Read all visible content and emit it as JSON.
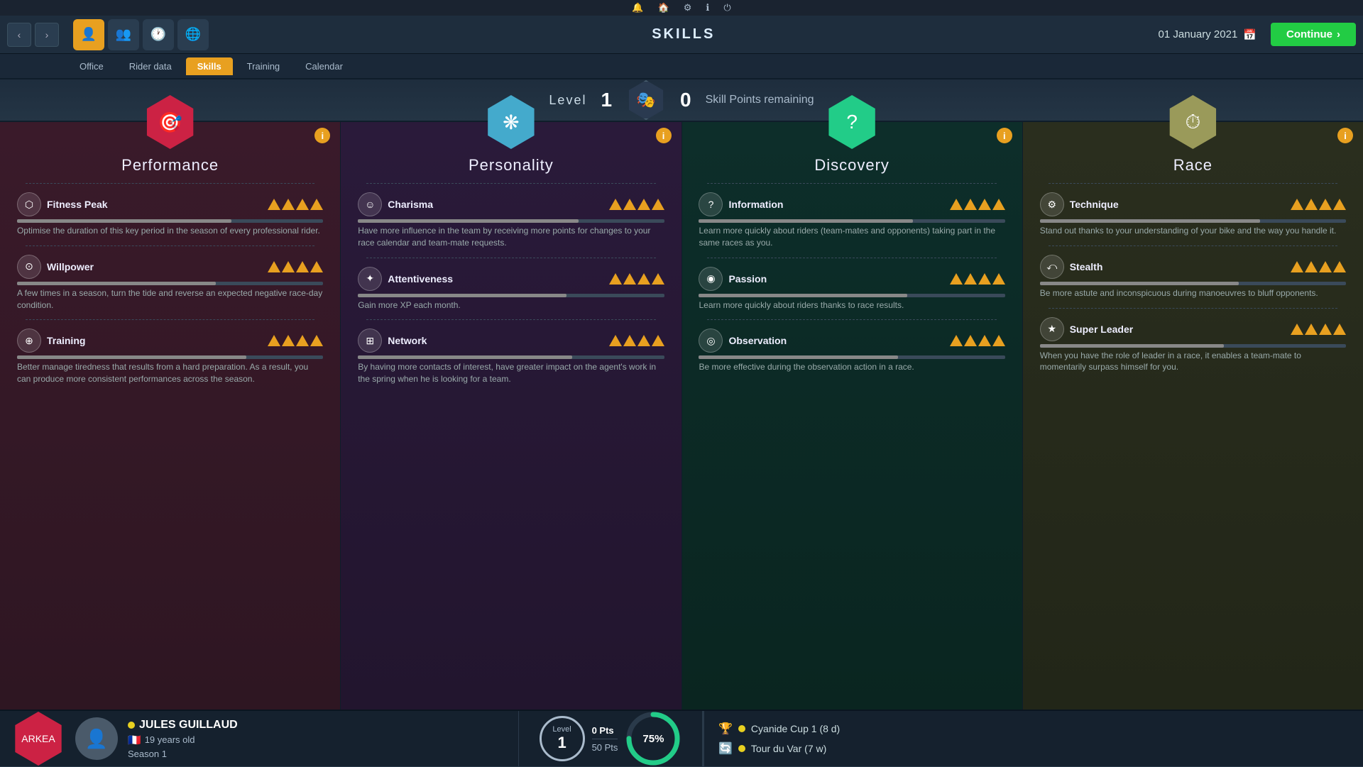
{
  "topbar": {
    "icons": [
      "🔔",
      "🏠",
      "⚙",
      "ℹ",
      "⏻"
    ]
  },
  "navbar": {
    "title": "SKILLS",
    "date": "01 January 2021",
    "continue_label": "Continue"
  },
  "tabs": {
    "items": [
      "Office",
      "Rider data",
      "Skills",
      "Training",
      "Calendar"
    ],
    "active": "Skills"
  },
  "level_bar": {
    "level_label": "Level",
    "level_value": "1",
    "skill_points": "0",
    "skill_points_label": "Skill Points remaining"
  },
  "cards": [
    {
      "id": "performance",
      "title": "Performance",
      "hex_color": "red",
      "icon": "🎯",
      "skills": [
        {
          "name": "Fitness Peak",
          "icon": "⬡",
          "filled": 4,
          "total": 4,
          "bar_pct": 70,
          "desc": "Optimise the duration of this key period in the season of every professional rider."
        },
        {
          "name": "Willpower",
          "icon": "⊙",
          "filled": 4,
          "total": 4,
          "bar_pct": 65,
          "desc": "A few times in a season, turn the tide and reverse an expected negative race-day condition."
        },
        {
          "name": "Training",
          "icon": "⊕",
          "filled": 4,
          "total": 4,
          "bar_pct": 75,
          "desc": "Better manage tiredness that results from a hard preparation. As a result, you can produce more consistent performances across the season."
        }
      ]
    },
    {
      "id": "personality",
      "title": "Personality",
      "hex_color": "blue",
      "icon": "❋",
      "skills": [
        {
          "name": "Charisma",
          "icon": "☺",
          "filled": 4,
          "total": 4,
          "bar_pct": 72,
          "desc": "Have more influence in the team by receiving more points for changes to your race calendar and team-mate requests."
        },
        {
          "name": "Attentiveness",
          "icon": "✦",
          "filled": 4,
          "total": 4,
          "bar_pct": 68,
          "desc": "Gain more XP each month."
        },
        {
          "name": "Network",
          "icon": "⊞",
          "filled": 4,
          "total": 4,
          "bar_pct": 70,
          "desc": "By having more contacts of interest, have greater impact on the agent's work in the spring when he is looking for a team."
        }
      ]
    },
    {
      "id": "discovery",
      "title": "Discovery",
      "hex_color": "green",
      "icon": "?",
      "skills": [
        {
          "name": "Information",
          "icon": "?",
          "filled": 4,
          "total": 4,
          "bar_pct": 70,
          "desc": "Learn more quickly about riders (team-mates and opponents) taking part in the same races as you."
        },
        {
          "name": "Passion",
          "icon": "◉",
          "filled": 4,
          "total": 4,
          "bar_pct": 68,
          "desc": "Learn more quickly about riders thanks to race results."
        },
        {
          "name": "Observation",
          "icon": "◎",
          "filled": 4,
          "total": 4,
          "bar_pct": 65,
          "desc": "Be more effective during the observation action in a race."
        }
      ]
    },
    {
      "id": "race",
      "title": "Race",
      "hex_color": "khaki",
      "icon": "⏱",
      "skills": [
        {
          "name": "Technique",
          "icon": "⚙",
          "filled": 4,
          "total": 4,
          "bar_pct": 72,
          "desc": "Stand out thanks to your understanding of your bike and the way you handle it."
        },
        {
          "name": "Stealth",
          "icon": "⤺",
          "filled": 4,
          "total": 4,
          "bar_pct": 65,
          "desc": "Be more astute and inconspicuous during manoeuvres to bluff opponents."
        },
        {
          "name": "Super Leader",
          "icon": "★",
          "filled": 4,
          "total": 4,
          "bar_pct": 60,
          "desc": "When you have the role of leader in a race, it enables a team-mate to momentarily surpass himself for you."
        }
      ]
    }
  ],
  "bottom": {
    "rider": {
      "name": "JULES GUILLAUD",
      "age": "19 years old",
      "season": "Season 1"
    },
    "level": {
      "label": "Level",
      "value": "1",
      "current_pts": "0 Pts",
      "total_pts": "50 Pts"
    },
    "progress": "75%",
    "races": [
      {
        "icon": "🏆",
        "name": "Cyanide Cup 1",
        "detail": "(8 d)"
      },
      {
        "icon": "🔄",
        "name": "Tour du Var",
        "detail": "(7 w)"
      }
    ]
  }
}
